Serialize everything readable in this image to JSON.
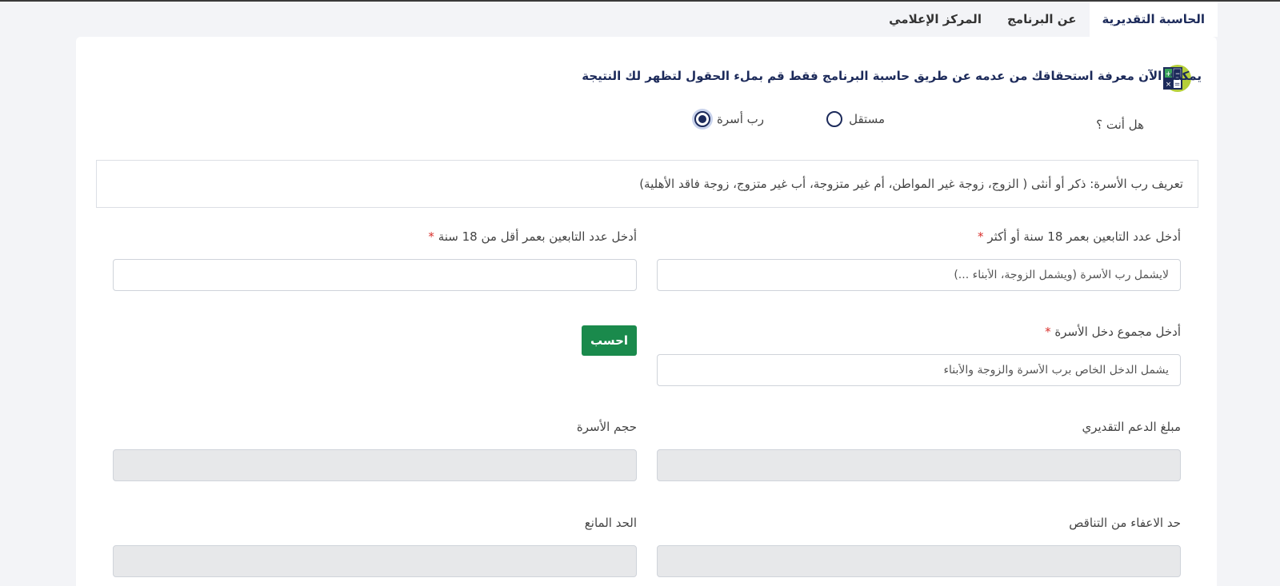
{
  "tabs": [
    "الحاسبة التقديرية",
    "عن البرنامج",
    "المركز الإعلامي"
  ],
  "headline": "يمكنك الآن معرفة استحقاقك من عدمه عن طريق حاسبة البرنامج فقط قم بملء الحقول لتظهر لك النتيجة",
  "question": "هل أنت ؟",
  "radio_options": {
    "independent": "مستقل",
    "head_of_family": "رب أسرة"
  },
  "selected_option": "رب أسرة",
  "definition": "تعريف رب الأسرة: ذكر أو أنثى ( الزوج، زوجة غير المواطن، أم غير متزوجة، أب غير متزوج، زوجة فاقد الأهلية)",
  "fields": {
    "adults_label": "أدخل عدد التابعين بعمر 18 سنة أو أكثر",
    "adults_placeholder": "لايشمل رب الأسرة (ويشمل الزوجة، الأبناء ...)",
    "minors_label": "أدخل عدد التابعين بعمر أقل من 18 سنة",
    "minors_placeholder": "",
    "income_label": "أدخل مجموع دخل الأسرة",
    "income_placeholder": "يشمل الدخل الخاص برب الأسرة والزوجة والأبناء",
    "support_label": "مبلغ الدعم التقديري",
    "family_size_label": "حجم الأسرة",
    "exemption_label": "حد الاعفاء من التناقص",
    "threshold_label": "الحد المانع"
  },
  "required_mark": "*",
  "calculate_button": "احسب",
  "colors": {
    "primary": "#1c2a5a",
    "button": "#1a8a4c",
    "required": "#d9302c"
  }
}
